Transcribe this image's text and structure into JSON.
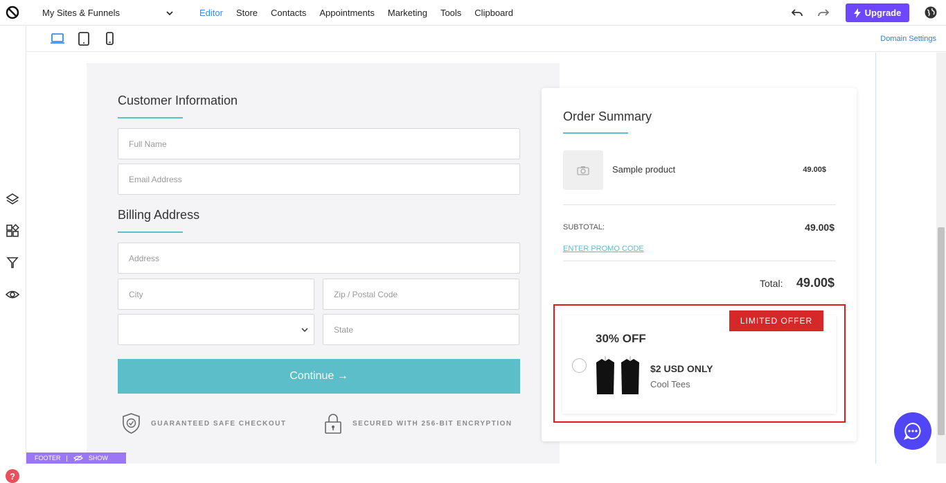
{
  "topbar": {
    "site_select": "My Sites & Funnels",
    "nav": [
      "Editor",
      "Store",
      "Contacts",
      "Appointments",
      "Marketing",
      "Tools",
      "Clipboard"
    ],
    "active_nav": "Editor",
    "upgrade_label": "Upgrade",
    "accent": "#6c47ff"
  },
  "devicebar": {
    "domain_settings": "Domain Settings"
  },
  "form": {
    "customer_title": "Customer Information",
    "full_name_placeholder": "Full Name",
    "email_placeholder": "Email Address",
    "billing_title": "Billing Address",
    "address_placeholder": "Address",
    "city_placeholder": "City",
    "zip_placeholder": "Zip / Postal Code",
    "state_placeholder": "State",
    "country_value": "",
    "continue_label": "Continue →",
    "trust_checkout": "GUARANTEED SAFE CHECKOUT",
    "trust_encryption": "SECURED WITH 256-BIT ENCRYPTION",
    "button_color": "#5bbec9"
  },
  "summary": {
    "title": "Order Summary",
    "product_name": "Sample product",
    "product_price": "49.00$",
    "subtotal_label": "SUBTOTAL:",
    "subtotal_value": "49.00$",
    "promo_label": "ENTER PROMO CODE",
    "total_label": "Total:",
    "total_value": "49.00$"
  },
  "offer": {
    "badge": "LIMITED OFFER",
    "title": "30% OFF",
    "price": "$2 USD ONLY",
    "product": "Cool Tees",
    "badge_color": "#d62828"
  },
  "footer": {
    "label": "FOOTER",
    "show_label": "SHOW"
  },
  "rail": {
    "help": "?"
  }
}
